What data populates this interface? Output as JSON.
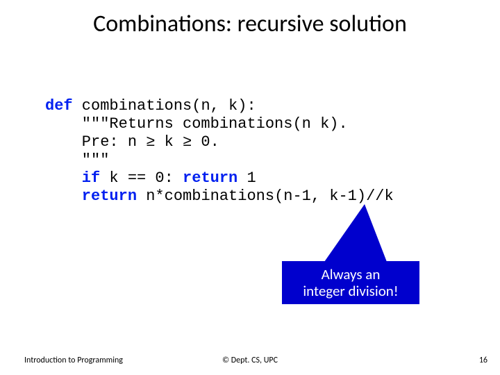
{
  "slide": {
    "title": "Combinations: recursive solution",
    "code": {
      "l1_def": "def",
      "l1_rest": " combinations(n, k):",
      "l2": "    \"\"\"Returns combinations(n k).",
      "l3": "    Pre: n ≥ k ≥ 0.",
      "l4": "    \"\"\"",
      "l5_if": "    if",
      "l5_mid": " k == 0: ",
      "l5_ret": "return",
      "l5_end": " 1",
      "l6_ret": "    return",
      "l6_end": " n*combinations(n-1, k-1)//k"
    },
    "callout": {
      "line1": "Always an",
      "line2": "integer division!"
    },
    "footer": {
      "left": "Introduction to Programming",
      "center": "© Dept. CS, UPC",
      "right": "16"
    },
    "colors": {
      "keyword": "#0020f0",
      "callout_bg": "#0000cd"
    }
  }
}
